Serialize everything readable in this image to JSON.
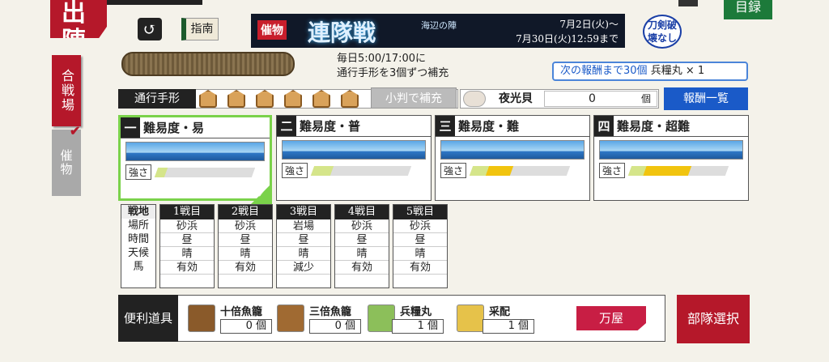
{
  "nav": {
    "sortie_tab": "出陣",
    "top_right_tab": "目録",
    "side_main": "合戦場",
    "side_event": "催物",
    "return_icon": "↺",
    "guide": "指南"
  },
  "banner": {
    "tag": "催物",
    "title": "連隊戦",
    "subtitle": "海辺の陣",
    "date_start": "7月2日(火)〜",
    "date_end": "7月30日(火)12:59まで"
  },
  "no_break": "刀剣破壊なし",
  "info_line1": "毎日5:00/17:00に",
  "info_line2": "通行手形を3個ずつ補充",
  "next_reward": {
    "prefix": "次の報酬まで",
    "count": "30個",
    "item": "兵糧丸 × 1"
  },
  "pass": {
    "label": "通行手形",
    "refill": "小判で補充",
    "icons": 6
  },
  "shell": {
    "label": "夜光貝",
    "value": "0",
    "unit": "個"
  },
  "reward_list": "報酬一覧",
  "difficulties": [
    {
      "num": "一",
      "label": "難易度・易",
      "strength": "強さ",
      "level": 1
    },
    {
      "num": "二",
      "label": "難易度・普",
      "strength": "強さ",
      "level": 2
    },
    {
      "num": "三",
      "label": "難易度・難",
      "strength": "強さ",
      "level": 3
    },
    {
      "num": "四",
      "label": "難易度・超難",
      "strength": "強さ",
      "level": 4
    }
  ],
  "battles": {
    "row_labels": [
      "戦地",
      "場所",
      "時間",
      "天候",
      "馬"
    ],
    "cols": [
      {
        "hd": "1戦目",
        "place": "砂浜",
        "time": "昼",
        "weather": "晴",
        "horse": "有効"
      },
      {
        "hd": "2戦目",
        "place": "砂浜",
        "time": "昼",
        "weather": "晴",
        "horse": "有効"
      },
      {
        "hd": "3戦目",
        "place": "岩場",
        "time": "昼",
        "weather": "晴",
        "horse": "減少"
      },
      {
        "hd": "4戦目",
        "place": "砂浜",
        "time": "昼",
        "weather": "晴",
        "horse": "有効"
      },
      {
        "hd": "5戦目",
        "place": "砂浜",
        "time": "昼",
        "weather": "晴",
        "horse": "有効"
      }
    ]
  },
  "tools": {
    "label": "便利道具",
    "items": [
      {
        "name": "十倍魚籠",
        "value": "0",
        "unit": "個"
      },
      {
        "name": "三倍魚籠",
        "value": "0",
        "unit": "個"
      },
      {
        "name": "兵糧丸",
        "value": "1",
        "unit": "個"
      },
      {
        "name": "采配",
        "value": "1",
        "unit": "個"
      }
    ]
  },
  "shop": "万屋",
  "unit_select": "部隊選択",
  "colors": {
    "accent_red": "#b5182a",
    "select_green": "#7ad24a",
    "blue": "#1a5ac8"
  }
}
